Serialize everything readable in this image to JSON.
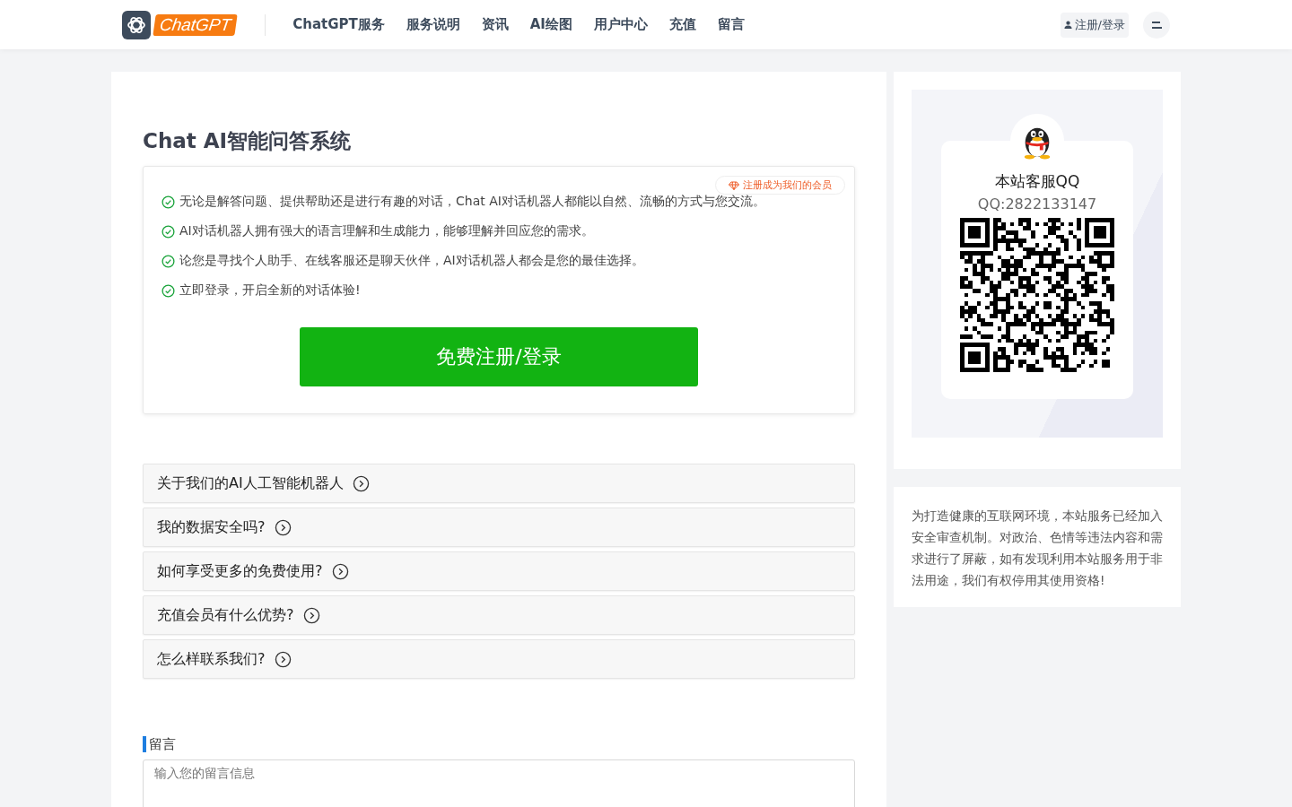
{
  "header": {
    "logo_text": "ChatGPT",
    "nav": [
      "ChatGPT服务",
      "服务说明",
      "资讯",
      "AI绘图",
      "用户中心",
      "充值",
      "留言"
    ],
    "login_button": "注册/登录"
  },
  "intro": {
    "title": "Chat AI智能问答系统",
    "member_badge": "注册成为我们的会员",
    "features": [
      "无论是解答问题、提供帮助还是进行有趣的对话，Chat AI对话机器人都能以自然、流畅的方式与您交流。",
      "AI对话机器人拥有强大的语言理解和生成能力，能够理解并回应您的需求。",
      "论您是寻找个人助手、在线客服还是聊天伙伴，AI对话机器人都会是您的最佳选择。",
      "立即登录，开启全新的对话体验!"
    ],
    "cta_button": "免费注册/登录"
  },
  "faq": [
    {
      "question": "关于我们的AI人工智能机器人",
      "expanded": false
    },
    {
      "question": "我的数据安全吗?",
      "expanded": false
    },
    {
      "question": "如何享受更多的免费使用?",
      "expanded": false
    },
    {
      "question": "充值会员有什么优势?",
      "expanded": false
    },
    {
      "question": "怎么样联系我们?",
      "expanded": false
    }
  ],
  "message": {
    "heading": "留言",
    "placeholder": "输入您的留言信息"
  },
  "contact_card": {
    "title": "本站客服QQ",
    "qq": "QQ:2822133147"
  },
  "notice": "为打造健康的互联网环境，本站服务已经加入安全审查机制。对政治、色情等违法内容和需求进行了屏蔽，如有发现利用本站服务用于非法用途，我们有权停用其使用资格!"
}
